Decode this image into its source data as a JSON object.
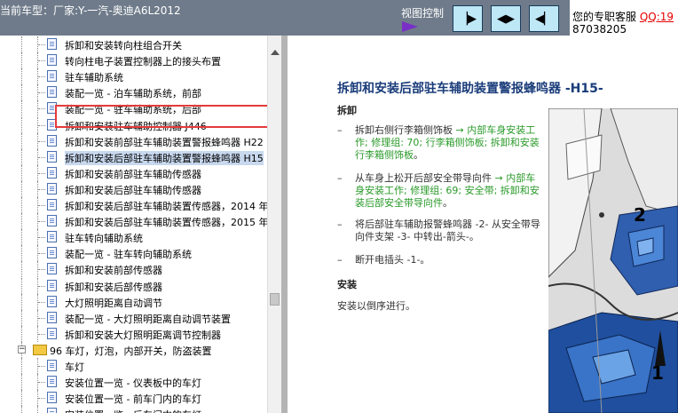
{
  "header": {
    "car_info": "当前车型：厂家:Y-一汽-奥迪A6L2012",
    "view_control_label": "视图控制",
    "buttons": [
      {
        "name": "show-left-panel",
        "glyph": "▕▶"
      },
      {
        "name": "split-view",
        "glyph": "◀▶"
      },
      {
        "name": "show-right-panel",
        "glyph": "◀▏"
      }
    ],
    "support_label": "您的专职客服",
    "support_qq": "QQ:19",
    "support_number": "87038205"
  },
  "tree": {
    "items": [
      {
        "label": "拆卸和安装转向柱组合开关",
        "level": 2
      },
      {
        "label": "转向柱电子装置控制器上的接头布置",
        "level": 2
      },
      {
        "label": "驻车辅助系统",
        "level": 2
      },
      {
        "label": "装配一览 - 泊车辅助系统，前部",
        "level": 2
      },
      {
        "label": "装配一览 - 驻车辅助系统，后部",
        "level": 2
      },
      {
        "label": "拆卸和安装驻车辅助控制器 J446",
        "level": 2
      },
      {
        "label": "拆卸和安装前部驻车辅助装置警报蜂鸣器 H22",
        "level": 2
      },
      {
        "label": "拆卸和安装后部驻车辅助装置警报蜂鸣器 H15",
        "level": 2,
        "selected": true
      },
      {
        "label": "拆卸和安装前部驻车辅助传感器",
        "level": 2
      },
      {
        "label": "拆卸和安装后部驻车辅助传感器",
        "level": 2
      },
      {
        "label": "拆卸和安装后部驻车辅助装置传感器，2014 年",
        "level": 2
      },
      {
        "label": "拆卸和安装后部驻车辅助装置传感器，2015 年",
        "level": 2
      },
      {
        "label": "驻车转向辅助系统",
        "level": 2
      },
      {
        "label": "装配一览 - 驻车转向辅助系统",
        "level": 2
      },
      {
        "label": "拆卸和安装前部传感器",
        "level": 2
      },
      {
        "label": "拆卸和安装后部传感器",
        "level": 2
      },
      {
        "label": "大灯照明距离自动调节",
        "level": 2
      },
      {
        "label": "装配一览 - 大灯照明距离自动调节装置",
        "level": 2
      },
      {
        "label": "拆卸和安装大灯照明距离调节控制器",
        "level": 2
      },
      {
        "label": "96 车灯，灯泡，内部开关，防盗装置",
        "level": 1,
        "folder": true
      },
      {
        "label": "车灯",
        "level": 2
      },
      {
        "label": "安装位置一览 - 仪表板中的车灯",
        "level": 2
      },
      {
        "label": "安装位置一览 - 前车门内的车灯",
        "level": 2
      },
      {
        "label": "安装位置一览 - 后车门内的车灯",
        "level": 2
      }
    ]
  },
  "document": {
    "title": "拆卸和安装后部驻车辅助装置警报蜂鸣器 -H15-",
    "removal_heading": "拆卸",
    "steps": [
      {
        "parts": [
          {
            "text": "拆卸右侧行李箱侧饰板 ",
            "green": false
          },
          {
            "text": "→ 内部车身安装工作; 修理组: 70; 行李箱侧饰板; 拆卸和安装行李箱侧饰板",
            "green": true
          },
          {
            "text": "。",
            "green": false
          }
        ]
      },
      {
        "parts": [
          {
            "text": "从车身上松开后部安全带导向件 ",
            "green": false
          },
          {
            "text": "→ 内部车身安装工作; 修理组: 69; 安全带; 拆卸和安装后部安全带导向件",
            "green": true
          },
          {
            "text": "。",
            "green": false
          }
        ]
      },
      {
        "parts": [
          {
            "text": "将后部驻车辅助报警蜂鸣器 -2- 从安全带导向件支架 -3- 中转出-箭头-。",
            "green": false
          }
        ]
      },
      {
        "parts": [
          {
            "text": "断开电插头 -1-。",
            "green": false
          }
        ]
      }
    ],
    "install_heading": "安装",
    "install_text": "安装以倒序进行。",
    "callouts": [
      "2",
      "1"
    ]
  },
  "colors": {
    "header_bg": "#6f7b8a",
    "title_blue": "#1a3c7a",
    "link_green": "#2a9a2a",
    "selection_red": "#e53a3a",
    "qq_red": "#e60000"
  }
}
